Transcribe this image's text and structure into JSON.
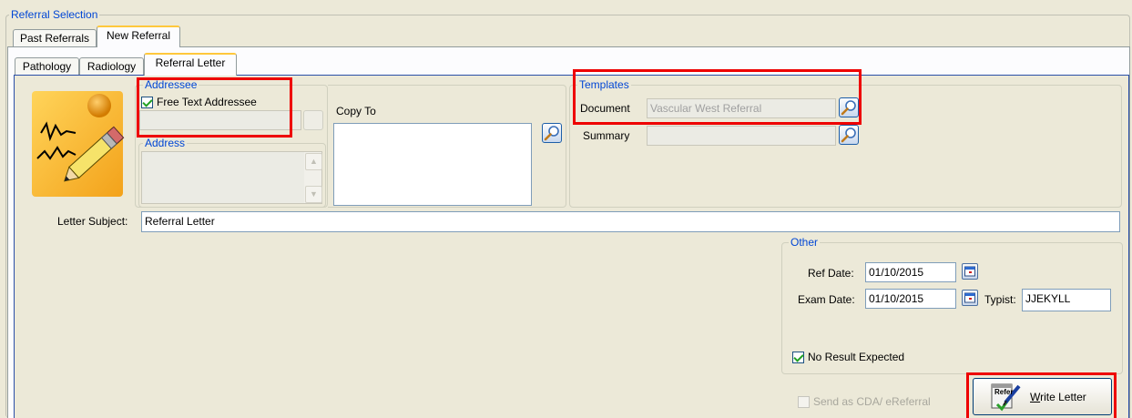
{
  "group_title": "Referral Selection",
  "top_tabs": [
    "Past Referrals",
    "New Referral"
  ],
  "sub_tabs": [
    "Pathology",
    "Radiology",
    "Referral Letter"
  ],
  "addressee": {
    "legend": "Addressee",
    "free_text_label": "Free Text Addressee",
    "free_text_checked": true,
    "address_legend": "Address"
  },
  "copy_to": {
    "label": "Copy To"
  },
  "templates": {
    "legend": "Templates",
    "document_label": "Document",
    "document_value": "Vascular West Referral",
    "summary_label": "Summary",
    "summary_value": ""
  },
  "letter_subject": {
    "label": "Letter Subject:",
    "value": "Referral Letter"
  },
  "other": {
    "legend": "Other",
    "ref_date_label": "Ref Date:",
    "ref_date_value": "01/10/2015",
    "exam_date_label": "Exam Date:",
    "exam_date_value": "01/10/2015",
    "typist_label": "Typist:",
    "typist_value": "JJEKYLL",
    "no_result_label": "No Result Expected",
    "no_result_checked": true
  },
  "send_cda_label": "Send as CDA/ eReferral",
  "write_letter": {
    "underline_char": "W",
    "rest": "rite Letter",
    "icon_text": "Refer"
  },
  "colors": {
    "highlight": "#ee0000",
    "legend_blue": "#0046d5",
    "window_bg": "#ece9d8"
  },
  "icons": [
    "notepad-pencil-icon",
    "magnifier-icon",
    "calendar-icon",
    "scroll-arrow-icon",
    "write-letter-icon"
  ]
}
